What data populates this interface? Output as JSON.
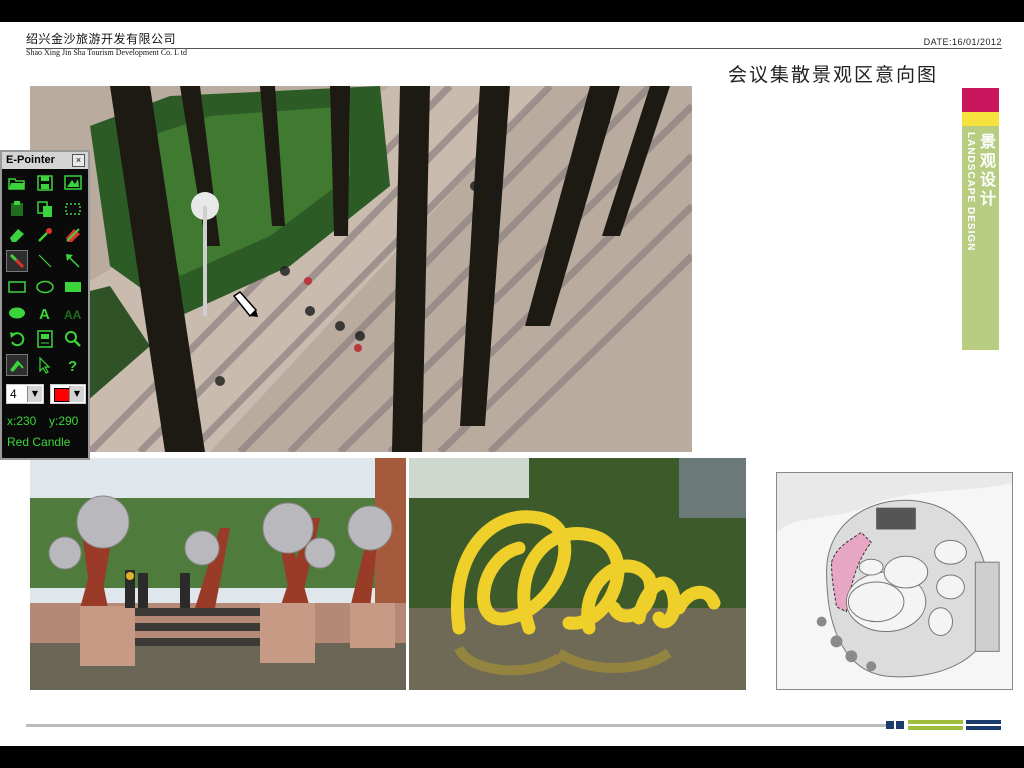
{
  "header": {
    "company_cn": "绍兴金沙旅游开发有限公司",
    "company_en": "Shao Xing Jin Sha Tourism Development Co. L td",
    "date": "DATE:16/01/2012"
  },
  "slide_title": "会议集散景观区意向图",
  "side_band": {
    "label_cn": "景观设计",
    "label_en": "LANDSCAPE  DESIGN",
    "colors": {
      "band": "#b8cd82",
      "magenta": "#c8155b",
      "yellow": "#f6e23c"
    }
  },
  "images": [
    {
      "name": "plaza-photo",
      "description_icon": "aerial-plaza-palms-image"
    },
    {
      "name": "fountain-spheres-photo",
      "description_icon": "sphere-sculpture-image"
    },
    {
      "name": "yellow-sculpture-photo",
      "description_icon": "ribbon-sculpture-image"
    },
    {
      "name": "site-plan",
      "description_icon": "site-plan-image"
    }
  ],
  "epointer": {
    "title": "E-Pointer",
    "close_label": "×",
    "tools": [
      "open-icon",
      "save-icon",
      "screen-icon",
      "paste-icon",
      "copy-icon",
      "select-rect-icon",
      "eraser-icon",
      "dropper-icon",
      "clear-icon",
      "pen-icon",
      "line-icon",
      "arrow-icon",
      "rectangle-icon",
      "ellipse-icon",
      "filled-rect-icon",
      "filled-ellipse-icon",
      "text-icon",
      "text-outline-icon",
      "undo-icon",
      "whiteboard-icon",
      "zoom-icon",
      "marker-icon",
      "pointer-icon",
      "help-icon"
    ],
    "line_width": "4",
    "color_value": "#ff0000",
    "x_label": "x:230",
    "y_label": "y:290",
    "color_name": "Red Candle",
    "accent": "#3cd43c"
  }
}
